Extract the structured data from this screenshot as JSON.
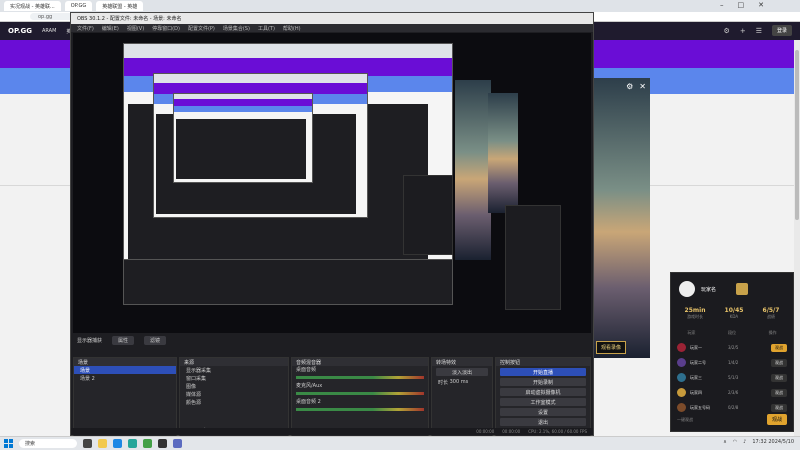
{
  "browser": {
    "tabs": [
      "实况观战 - 英雄联...",
      "OP.GG",
      "英雄联盟 - 英雄"
    ],
    "url": "op.gg",
    "logo": "OP.GG",
    "nav": [
      "ARAM",
      "英雄",
      "排行",
      "英雄联盟",
      "Pro"
    ],
    "nav_button": "登录"
  },
  "obs": {
    "title": "OBS 30.1.2 - 配置文件: 未命名 - 场景: 未命名",
    "menu": [
      "文件(F)",
      "编辑(E)",
      "视图(V)",
      "停靠窗口(D)",
      "配置文件(P)",
      "场景集合(S)",
      "工具(T)",
      "帮助(H)"
    ],
    "source_bar": {
      "label": "显示器捕获",
      "properties": "属性",
      "filters": "滤镜"
    },
    "docks": {
      "scenes": {
        "title": "场景",
        "items": [
          "场景",
          "场景 2"
        ]
      },
      "sources": {
        "title": "来源",
        "items": [
          "显示器采集",
          "窗口采集",
          "图像",
          "媒体源",
          "颜色源"
        ]
      },
      "mixer": {
        "title": "音频混音器",
        "channels": [
          "桌面音频",
          "麦克风/Aux",
          "桌面音频 2"
        ]
      },
      "transitions": {
        "title": "转场特效",
        "type": "淡入淡出",
        "duration_label": "时长",
        "duration": "300 ms"
      },
      "controls": {
        "title": "控制按钮",
        "buttons": [
          "开始直播",
          "开始录制",
          "启动虚拟摄像机",
          "工作室模式",
          "设置",
          "退出"
        ]
      }
    },
    "status": [
      "00:00:00",
      "00:00:00",
      "CPU: 2.1%, 60.00 / 60.00 FPS"
    ]
  },
  "splash": {
    "watch_label": "观看录像"
  },
  "card": {
    "name": "玩家名",
    "stats": [
      {
        "value": "25min",
        "label": "游戏时长"
      },
      {
        "value": "10/45",
        "label": "KDA"
      },
      {
        "value": "6/5/7",
        "label": "战绩"
      }
    ],
    "columns": [
      "玩家",
      "段位",
      "操作"
    ],
    "players": [
      {
        "name": "玩家一",
        "score": "3/2/5",
        "action": "观战",
        "gold": true,
        "color": "#9b2335"
      },
      {
        "name": "玩家二号",
        "score": "1/4/2",
        "action": "观战",
        "gold": false,
        "color": "#5a3e8c"
      },
      {
        "name": "玩家三",
        "score": "5/1/3",
        "action": "观战",
        "gold": false,
        "color": "#2e6f8e"
      },
      {
        "name": "玩家四",
        "score": "2/3/6",
        "action": "观战",
        "gold": false,
        "color": "#c79a3b"
      },
      {
        "name": "玩家五号码",
        "score": "0/2/8",
        "action": "观战",
        "gold": false,
        "color": "#7c4b2a"
      }
    ],
    "footer_hint": "一键观战",
    "join_label": "观战"
  },
  "taskbar": {
    "search_placeholder": "搜索",
    "time": "17:32",
    "date": "2024/5/10"
  }
}
